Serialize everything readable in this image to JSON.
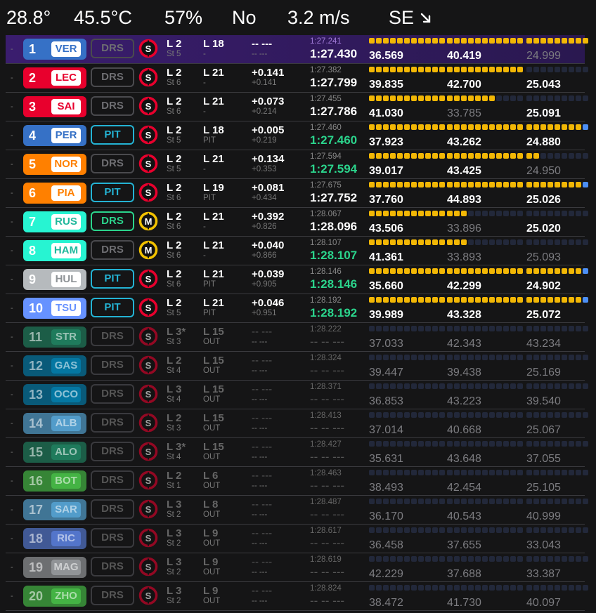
{
  "weather": {
    "air_temp": "28.8°",
    "track_temp": "45.5°C",
    "humidity": "57%",
    "rain": "No",
    "wind_speed": "3.2 m/s",
    "wind_dir": "SE",
    "wind_icon": "arrow-down-right-icon"
  },
  "rows": [
    {
      "pos": "1",
      "code": "VER",
      "color": "#3671C6",
      "code_color": "#3671C6",
      "drs": "DRS",
      "drs_state": "off",
      "tyre": "S",
      "tyre_color": "#e8002d",
      "l1": "L 2",
      "l2": "St 5",
      "la": "L 18",
      "lb": "-",
      "g1": "-- ---",
      "g2": "-- ---",
      "best": "1:27.241",
      "last": "1:27.430",
      "best_purple": true,
      "last_green": false,
      "s1": "36.569",
      "s2": "40.419",
      "s3": "24.999",
      "s3dim": true,
      "d1": "yyyyyyyyyyy",
      "d2": "yyyyyyyyyyy",
      "d3": "yyyyyyyyy",
      "out": false
    },
    {
      "pos": "2",
      "code": "LEC",
      "color": "#E8002D",
      "code_color": "#E8002D",
      "drs": "DRS",
      "drs_state": "off",
      "tyre": "S",
      "tyre_color": "#e8002d",
      "l1": "L 2",
      "l2": "St 6",
      "la": "L 21",
      "lb": "-",
      "g1": "+0.141",
      "g2": "+0.141",
      "best": "1:27.382",
      "last": "1:27.799",
      "best_purple": false,
      "last_green": false,
      "s1": "39.835",
      "s2": "42.700",
      "s3": "25.043",
      "s3dim": false,
      "d1": "yyyyyyyyyyy",
      "d2": "yyyyyyyyyyy",
      "d3": "nnnnnnnnn",
      "out": false
    },
    {
      "pos": "3",
      "code": "SAI",
      "color": "#E8002D",
      "code_color": "#E8002D",
      "drs": "DRS",
      "drs_state": "off",
      "tyre": "S",
      "tyre_color": "#e8002d",
      "l1": "L 2",
      "l2": "St 6",
      "la": "L 21",
      "lb": "-",
      "g1": "+0.073",
      "g2": "+0.214",
      "best": "1:27.455",
      "last": "1:27.786",
      "best_purple": false,
      "last_green": false,
      "s1": "41.030",
      "s2": "33.785",
      "s3": "25.091",
      "s3dim": false,
      "d1": "yyyyyyyyyyy",
      "d2": "yyyyyyynnnn",
      "d3": "nnnnnnnnn",
      "out": false,
      "s2dim": true
    },
    {
      "pos": "4",
      "code": "PER",
      "color": "#3671C6",
      "code_color": "#3671C6",
      "drs": "PIT",
      "drs_state": "pit",
      "tyre": "S",
      "tyre_color": "#e8002d",
      "l1": "L 2",
      "l2": "St 5",
      "la": "L 18",
      "lb": "PIT",
      "g1": "+0.005",
      "g2": "+0.219",
      "best": "1:27.460",
      "last": "1:27.460",
      "best_purple": false,
      "last_green": true,
      "s1": "37.923",
      "s2": "43.262",
      "s3": "24.880",
      "s3dim": false,
      "d1": "yyyyyyyyyyy",
      "d2": "yyyyyyyyyyy",
      "d3": "yyyyyyyyb",
      "out": false
    },
    {
      "pos": "5",
      "code": "NOR",
      "color": "#FF8000",
      "code_color": "#FF8000",
      "drs": "DRS",
      "drs_state": "off",
      "tyre": "S",
      "tyre_color": "#e8002d",
      "l1": "L 2",
      "l2": "St 5",
      "la": "L 21",
      "lb": "-",
      "g1": "+0.134",
      "g2": "+0.353",
      "best": "1:27.594",
      "last": "1:27.594",
      "best_purple": false,
      "last_green": true,
      "s1": "39.017",
      "s2": "43.425",
      "s3": "24.950",
      "s3dim": true,
      "d1": "yyyyyyyyyyy",
      "d2": "yyyyyyyyyyy",
      "d3": "yynnnnnnn",
      "out": false
    },
    {
      "pos": "6",
      "code": "PIA",
      "color": "#FF8000",
      "code_color": "#FF8000",
      "drs": "PIT",
      "drs_state": "pit",
      "tyre": "S",
      "tyre_color": "#e8002d",
      "l1": "L 2",
      "l2": "St 6",
      "la": "L 19",
      "lb": "PIT",
      "g1": "+0.081",
      "g2": "+0.434",
      "best": "1:27.675",
      "last": "1:27.752",
      "best_purple": false,
      "last_green": false,
      "s1": "37.760",
      "s2": "44.893",
      "s3": "25.026",
      "s3dim": false,
      "d1": "yyyyyyyyyyy",
      "d2": "yyyyyyyyyyy",
      "d3": "yyyyyyyyb",
      "out": false
    },
    {
      "pos": "7",
      "code": "RUS",
      "color": "#27F4D2",
      "code_color": "#1fb89c",
      "drs": "DRS",
      "drs_state": "on",
      "tyre": "M",
      "tyre_color": "#f2c200",
      "l1": "L 2",
      "l2": "St 6",
      "la": "L 21",
      "lb": "-",
      "g1": "+0.392",
      "g2": "+0.826",
      "best": "1:28.067",
      "last": "1:28.096",
      "best_purple": false,
      "last_green": false,
      "s1": "43.506",
      "s2": "33.896",
      "s3": "25.020",
      "s3dim": false,
      "d1": "yyyyyyyyyyy",
      "d2": "yyynnnnnnnn",
      "d3": "nnnnnnnnn",
      "out": false,
      "s2dim": true
    },
    {
      "pos": "8",
      "code": "HAM",
      "color": "#27F4D2",
      "code_color": "#1fb89c",
      "drs": "DRS",
      "drs_state": "off",
      "tyre": "M",
      "tyre_color": "#f2c200",
      "l1": "L 2",
      "l2": "St 6",
      "la": "L 21",
      "lb": "-",
      "g1": "+0.040",
      "g2": "+0.866",
      "best": "1:28.107",
      "last": "1:28.107",
      "best_purple": false,
      "last_green": true,
      "s1": "41.361",
      "s2": "33.893",
      "s3": "25.093",
      "s3dim": true,
      "d1": "yyyyyyyyyyy",
      "d2": "yyynnnnnnnn",
      "d3": "nnnnnnnnn",
      "out": false,
      "s2dim": true
    },
    {
      "pos": "9",
      "code": "HUL",
      "color": "#B6BABD",
      "code_color": "#8e9396",
      "drs": "PIT",
      "drs_state": "pit",
      "tyre": "S",
      "tyre_color": "#e8002d",
      "l1": "L 2",
      "l2": "St 6",
      "la": "L 21",
      "lb": "PIT",
      "g1": "+0.039",
      "g2": "+0.905",
      "best": "1:28.146",
      "last": "1:28.146",
      "best_purple": false,
      "last_green": true,
      "s1": "35.660",
      "s2": "42.299",
      "s3": "24.902",
      "s3dim": false,
      "d1": "yyyyyyyyyyy",
      "d2": "yyyyyyyyyyy",
      "d3": "yyyyyyyyb",
      "out": false
    },
    {
      "pos": "10",
      "code": "TSU",
      "color": "#6692FF",
      "code_color": "#6692FF",
      "drs": "PIT",
      "drs_state": "pit",
      "tyre": "S",
      "tyre_color": "#e8002d",
      "l1": "L 2",
      "l2": "St 5",
      "la": "L 21",
      "lb": "PIT",
      "g1": "+0.046",
      "g2": "+0.951",
      "best": "1:28.192",
      "last": "1:28.192",
      "best_purple": false,
      "last_green": true,
      "s1": "39.989",
      "s2": "43.328",
      "s3": "25.072",
      "s3dim": false,
      "d1": "yyyyyyyyyyy",
      "d2": "yyyyyyyyyyy",
      "d3": "yyyyyyyyb",
      "out": false
    },
    {
      "pos": "11",
      "code": "STR",
      "color": "#229971",
      "code_color": "#229971",
      "drs": "DRS",
      "drs_state": "dim",
      "tyre": "S",
      "tyre_color": "#e8002d",
      "l1": "L 3*",
      "l2": "St 3",
      "la": "L 15",
      "lb": "OUT",
      "g1": "-- ---",
      "g2": "-- ---",
      "best": "1:28.222",
      "last": "-- -- ---",
      "s1": "37.033",
      "s2": "42.343",
      "s3": "43.234",
      "d1": "nnnnnnnnnnn",
      "d2": "nnnnnnnnnnn",
      "d3": "nnnnnnnnn",
      "out": true
    },
    {
      "pos": "12",
      "code": "GAS",
      "color": "#0093CC",
      "code_color": "#0093CC",
      "drs": "DRS",
      "drs_state": "dim",
      "tyre": "S",
      "tyre_color": "#e8002d",
      "l1": "L 2",
      "l2": "St 4",
      "la": "L 15",
      "lb": "OUT",
      "g1": "-- ---",
      "g2": "-- ---",
      "best": "1:28.324",
      "last": "-- -- ---",
      "s1": "39.447",
      "s2": "39.438",
      "s3": "25.169",
      "d1": "nnnnnnnnnnn",
      "d2": "nnnnnnnnnnn",
      "d3": "nnnnnnnnn",
      "out": true
    },
    {
      "pos": "13",
      "code": "OCO",
      "color": "#0093CC",
      "code_color": "#0093CC",
      "drs": "DRS",
      "drs_state": "dim",
      "tyre": "S",
      "tyre_color": "#e8002d",
      "l1": "L 3",
      "l2": "St 4",
      "la": "L 15",
      "lb": "OUT",
      "g1": "-- ---",
      "g2": "-- ---",
      "best": "1:28.371",
      "last": "-- -- ---",
      "s1": "36.853",
      "s2": "43.223",
      "s3": "39.540",
      "d1": "nnnnnnnnnnn",
      "d2": "nnnnnnnnnnn",
      "d3": "nnnnnnnnn",
      "out": true
    },
    {
      "pos": "14",
      "code": "ALB",
      "color": "#64C4FF",
      "code_color": "#64C4FF",
      "drs": "DRS",
      "drs_state": "dim",
      "tyre": "S",
      "tyre_color": "#e8002d",
      "l1": "L 2",
      "l2": "St 3",
      "la": "L 15",
      "lb": "OUT",
      "g1": "-- ---",
      "g2": "-- ---",
      "best": "1:28.413",
      "last": "-- -- ---",
      "s1": "37.014",
      "s2": "40.668",
      "s3": "25.067",
      "d1": "nnnnnnnnnnn",
      "d2": "nnnnnnnnnnn",
      "d3": "nnnnnnnnn",
      "out": true
    },
    {
      "pos": "15",
      "code": "ALO",
      "color": "#229971",
      "code_color": "#229971",
      "drs": "DRS",
      "drs_state": "dim",
      "tyre": "S",
      "tyre_color": "#e8002d",
      "l1": "L 3*",
      "l2": "St 4",
      "la": "L 15",
      "lb": "OUT",
      "g1": "-- ---",
      "g2": "-- ---",
      "best": "1:28.427",
      "last": "-- -- ---",
      "s1": "35.631",
      "s2": "43.648",
      "s3": "37.055",
      "d1": "nnnnnnnnnnn",
      "d2": "nnnnnnnnnnn",
      "d3": "nnnnnnnnn",
      "out": true
    },
    {
      "pos": "16",
      "code": "BOT",
      "color": "#52E252",
      "code_color": "#3aa83a",
      "drs": "DRS",
      "drs_state": "dim",
      "tyre": "S",
      "tyre_color": "#e8002d",
      "l1": "L 2",
      "l2": "St 1",
      "la": "L 6",
      "lb": "OUT",
      "g1": "-- ---",
      "g2": "-- ---",
      "best": "1:28.463",
      "last": "-- -- ---",
      "s1": "38.493",
      "s2": "42.454",
      "s3": "25.105",
      "d1": "nnnnnnnnnnn",
      "d2": "nnnnnnnnnnn",
      "d3": "nnnnnnnnn",
      "out": true
    },
    {
      "pos": "17",
      "code": "SAR",
      "color": "#64C4FF",
      "code_color": "#64C4FF",
      "drs": "DRS",
      "drs_state": "dim",
      "tyre": "S",
      "tyre_color": "#e8002d",
      "l1": "L 3",
      "l2": "St 2",
      "la": "L 8",
      "lb": "OUT",
      "g1": "-- ---",
      "g2": "-- ---",
      "best": "1:28.487",
      "last": "-- -- ---",
      "s1": "36.170",
      "s2": "40.543",
      "s3": "40.999",
      "d1": "nnnnnnnnnnn",
      "d2": "nnnnnnnnnnn",
      "d3": "nnnnnnnnn",
      "out": true
    },
    {
      "pos": "18",
      "code": "RIC",
      "color": "#6692FF",
      "code_color": "#6692FF",
      "drs": "DRS",
      "drs_state": "dim",
      "tyre": "S",
      "tyre_color": "#e8002d",
      "l1": "L 3",
      "l2": "St 2",
      "la": "L 9",
      "lb": "OUT",
      "g1": "-- ---",
      "g2": "-- ---",
      "best": "1:28.617",
      "last": "-- -- ---",
      "s1": "36.458",
      "s2": "37.655",
      "s3": "33.043",
      "d1": "nnnnnnnnnnn",
      "d2": "nnnnnnnnnnn",
      "d3": "nnnnnnnnn",
      "out": true
    },
    {
      "pos": "19",
      "code": "MAG",
      "color": "#B6BABD",
      "code_color": "#8e9396",
      "drs": "DRS",
      "drs_state": "dim",
      "tyre": "S",
      "tyre_color": "#e8002d",
      "l1": "L 3",
      "l2": "St 2",
      "la": "L 9",
      "lb": "OUT",
      "g1": "-- ---",
      "g2": "-- ---",
      "best": "1:28.619",
      "last": "-- -- ---",
      "s1": "42.229",
      "s2": "37.688",
      "s3": "33.387",
      "d1": "nnnnnnnnnnn",
      "d2": "nnnnnnnnnnn",
      "d3": "nnnnnnnnn",
      "out": true
    },
    {
      "pos": "20",
      "code": "ZHO",
      "color": "#52E252",
      "code_color": "#3aa83a",
      "drs": "DRS",
      "drs_state": "dim",
      "tyre": "S",
      "tyre_color": "#e8002d",
      "l1": "L 3",
      "l2": "St 2",
      "la": "L 9",
      "lb": "OUT",
      "g1": "-- ---",
      "g2": "-- ---",
      "best": "1:28.824",
      "last": "-- -- ---",
      "s1": "38.472",
      "s2": "41.730",
      "s3": "40.097",
      "d1": "nnnnnnnnnnn",
      "d2": "nnnnnnnnnnn",
      "d3": "nnnnnnnnn",
      "out": true
    }
  ]
}
